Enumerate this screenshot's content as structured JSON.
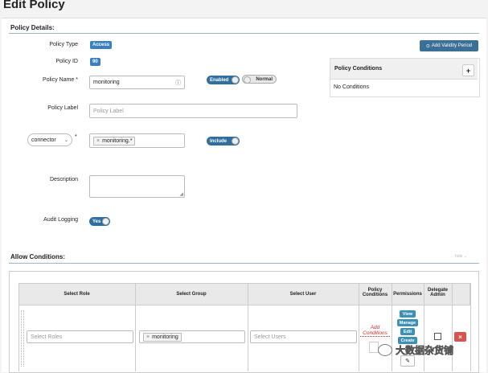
{
  "page": {
    "title": "Edit Policy"
  },
  "policy_details": {
    "section_title": "Policy Details:",
    "policy_type_label": "Policy Type",
    "policy_type_value": "Access",
    "policy_id_label": "Policy ID",
    "policy_id_value": "90",
    "policy_name_label": "Policy Name *",
    "policy_name_value": "monitoring",
    "enabled_toggle": "Enabled",
    "normal_toggle": "Normal",
    "policy_label_label": "Policy Label",
    "policy_label_placeholder": "Policy Label",
    "resource_select": "connector",
    "resource_required": "*",
    "resource_tag": "monitoring.*",
    "include_toggle": "Include",
    "description_label": "Description",
    "audit_logging_label": "Audit Logging",
    "audit_toggle": "Yes"
  },
  "validity": {
    "button_label": "Add Validity Period"
  },
  "policy_conditions": {
    "title": "Policy Conditions",
    "empty_text": "No Conditions",
    "add_symbol": "+"
  },
  "allow_conditions": {
    "section_title": "Allow Conditions:",
    "hide_label": "hide ⌄",
    "headers": {
      "role": "Select Role",
      "group": "Select Group",
      "user": "Select User",
      "policy_conditions_1": "Policy",
      "policy_conditions_2": "Conditions",
      "permissions": "Permissions",
      "delegate_1": "Delegate",
      "delegate_2": "Admin"
    },
    "row": {
      "roles_placeholder": "Select Roles",
      "group_tag": "monitoring",
      "users_placeholder": "Select Users",
      "add_conditions_1": "Add",
      "add_conditions_2": "Conditions",
      "permissions": [
        "View",
        "Manage",
        "Edit",
        "Create"
      ],
      "delete_symbol": "×"
    }
  },
  "watermark": {
    "text": "大数据杂货铺"
  }
}
